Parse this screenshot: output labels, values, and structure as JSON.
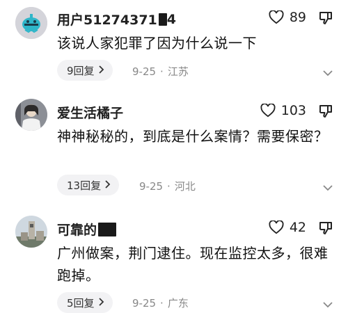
{
  "comments": [
    {
      "username": "用户51274371",
      "username_tail": "4",
      "likes": "89",
      "text": "该说人家犯罪了因为什么说一下",
      "replies": "9回复",
      "date": "9-25",
      "location": "江苏"
    },
    {
      "username": "爱生活橘子",
      "likes": "103",
      "text": "神神秘秘的，到底是什么案情？需要保密？",
      "replies": "13回复",
      "date": "9-25",
      "location": "河北"
    },
    {
      "username": "可靠的",
      "likes": "42",
      "text": "广州做案，荆门逮住。现在监控太多，很难跑掉。",
      "replies": "5回复",
      "date": "9-25",
      "location": "广东"
    }
  ],
  "icons": {
    "like": "heart-outline",
    "dislike": "thumbs-down-outline",
    "reply_arrow": "chevron-right",
    "collapse": "chevron-down"
  },
  "colors": {
    "text": "#111111",
    "meta": "#888888",
    "reply_bg": "#f2f2f4"
  }
}
